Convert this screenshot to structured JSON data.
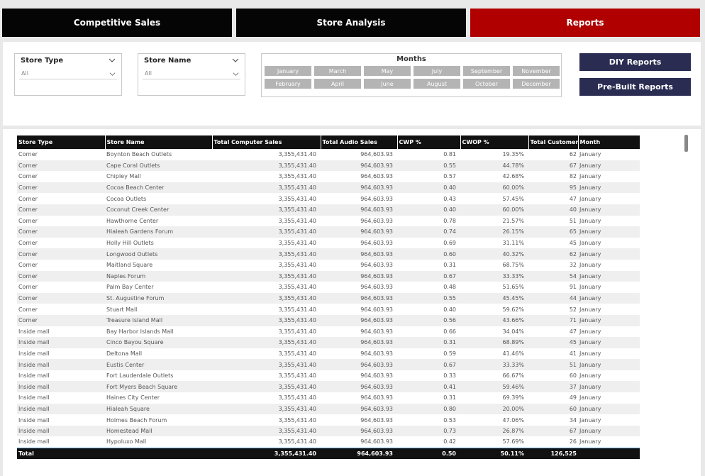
{
  "nav": {
    "tabs": [
      {
        "label": "Competitive Sales"
      },
      {
        "label": "Store Analysis"
      },
      {
        "label": "Reports"
      }
    ]
  },
  "filters": {
    "store_type": {
      "title": "Store Type",
      "value": "All"
    },
    "store_name": {
      "title": "Store Name",
      "value": "All"
    },
    "months": {
      "title": "Months",
      "items": [
        "January",
        "March",
        "May",
        "July",
        "September",
        "November",
        "February",
        "April",
        "June",
        "August",
        "October",
        "December"
      ]
    }
  },
  "reports": {
    "diy": "DIY Reports",
    "prebuilt": "Pre-Built Reports"
  },
  "table": {
    "headers": [
      "Store Type",
      "Store Name",
      "Total Computer Sales",
      "Total Audio Sales",
      "CWP %",
      "CWOP %",
      "Total Customers",
      "Month"
    ],
    "rows": [
      [
        "Corner",
        "Boynton Beach Outlets",
        "3,355,431.40",
        "964,603.93",
        "0.81",
        "19.35%",
        "62",
        "January"
      ],
      [
        "Corner",
        "Cape Coral Outlets",
        "3,355,431.40",
        "964,603.93",
        "0.55",
        "44.78%",
        "67",
        "January"
      ],
      [
        "Corner",
        "Chipley Mall",
        "3,355,431.40",
        "964,603.93",
        "0.57",
        "42.68%",
        "82",
        "January"
      ],
      [
        "Corner",
        "Cocoa Beach Center",
        "3,355,431.40",
        "964,603.93",
        "0.40",
        "60.00%",
        "95",
        "January"
      ],
      [
        "Corner",
        "Cocoa Outlets",
        "3,355,431.40",
        "964,603.93",
        "0.43",
        "57.45%",
        "47",
        "January"
      ],
      [
        "Corner",
        "Coconut Creek Center",
        "3,355,431.40",
        "964,603.93",
        "0.40",
        "60.00%",
        "40",
        "January"
      ],
      [
        "Corner",
        "Hawthorne Center",
        "3,355,431.40",
        "964,603.93",
        "0.78",
        "21.57%",
        "51",
        "January"
      ],
      [
        "Corner",
        "Hialeah Gardens Forum",
        "3,355,431.40",
        "964,603.93",
        "0.74",
        "26.15%",
        "65",
        "January"
      ],
      [
        "Corner",
        "Holly Hill Outlets",
        "3,355,431.40",
        "964,603.93",
        "0.69",
        "31.11%",
        "45",
        "January"
      ],
      [
        "Corner",
        "Longwood Outlets",
        "3,355,431.40",
        "964,603.93",
        "0.60",
        "40.32%",
        "62",
        "January"
      ],
      [
        "Corner",
        "Maitland Square",
        "3,355,431.40",
        "964,603.93",
        "0.31",
        "68.75%",
        "32",
        "January"
      ],
      [
        "Corner",
        "Naples Forum",
        "3,355,431.40",
        "964,603.93",
        "0.67",
        "33.33%",
        "54",
        "January"
      ],
      [
        "Corner",
        "Palm Bay Center",
        "3,355,431.40",
        "964,603.93",
        "0.48",
        "51.65%",
        "91",
        "January"
      ],
      [
        "Corner",
        "St. Augustine Forum",
        "3,355,431.40",
        "964,603.93",
        "0.55",
        "45.45%",
        "44",
        "January"
      ],
      [
        "Corner",
        "Stuart Mall",
        "3,355,431.40",
        "964,603.93",
        "0.40",
        "59.62%",
        "52",
        "January"
      ],
      [
        "Corner",
        "Treasure Island Mall",
        "3,355,431.40",
        "964,603.93",
        "0.56",
        "43.66%",
        "71",
        "January"
      ],
      [
        "Inside mall",
        "Bay Harbor Islands Mall",
        "3,355,431.40",
        "964,603.93",
        "0.66",
        "34.04%",
        "47",
        "January"
      ],
      [
        "Inside mall",
        "Cinco Bayou Square",
        "3,355,431.40",
        "964,603.93",
        "0.31",
        "68.89%",
        "45",
        "January"
      ],
      [
        "Inside mall",
        "Deltona Mall",
        "3,355,431.40",
        "964,603.93",
        "0.59",
        "41.46%",
        "41",
        "January"
      ],
      [
        "Inside mall",
        "Eustis Center",
        "3,355,431.40",
        "964,603.93",
        "0.67",
        "33.33%",
        "51",
        "January"
      ],
      [
        "Inside mall",
        "Fort Lauderdale Outlets",
        "3,355,431.40",
        "964,603.93",
        "0.33",
        "66.67%",
        "60",
        "January"
      ],
      [
        "Inside mall",
        "Fort Myers Beach Square",
        "3,355,431.40",
        "964,603.93",
        "0.41",
        "59.46%",
        "37",
        "January"
      ],
      [
        "Inside mall",
        "Haines City Center",
        "3,355,431.40",
        "964,603.93",
        "0.31",
        "69.39%",
        "49",
        "January"
      ],
      [
        "Inside mall",
        "Hialeah Square",
        "3,355,431.40",
        "964,603.93",
        "0.80",
        "20.00%",
        "60",
        "January"
      ],
      [
        "Inside mall",
        "Holmes Beach Forum",
        "3,355,431.40",
        "964,603.93",
        "0.53",
        "47.06%",
        "34",
        "January"
      ],
      [
        "Inside mall",
        "Homestead Mall",
        "3,355,431.40",
        "964,603.93",
        "0.73",
        "26.87%",
        "67",
        "January"
      ],
      [
        "Inside mall",
        "Hypoluxo Mall",
        "3,355,431.40",
        "964,603.93",
        "0.42",
        "57.69%",
        "26",
        "January"
      ]
    ],
    "total": [
      "Total",
      "",
      "3,355,431.40",
      "964,603.93",
      "0.50",
      "50.11%",
      "126,525",
      ""
    ]
  }
}
